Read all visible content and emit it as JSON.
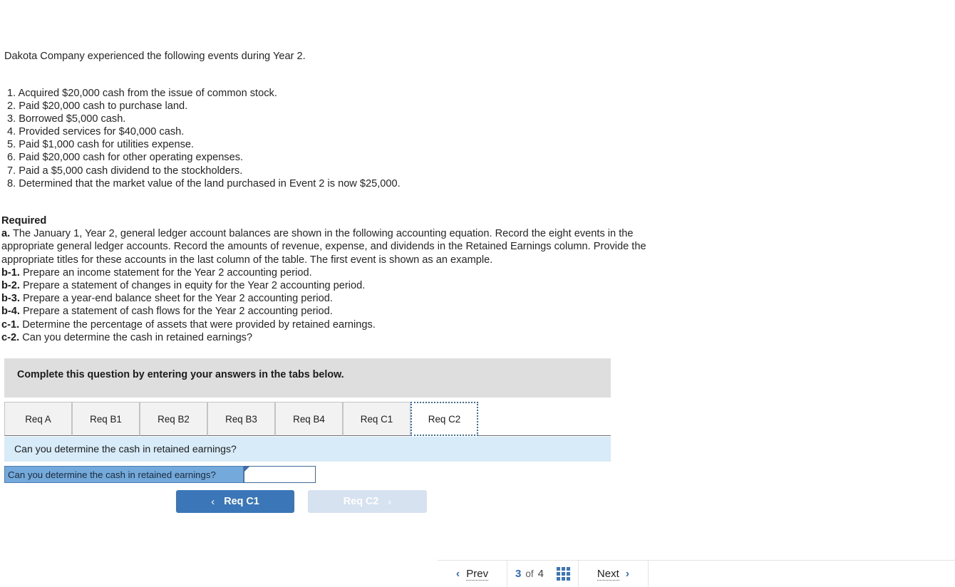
{
  "problem": {
    "intro": "Dakota Company experienced the following events during Year 2.",
    "events": [
      " 1. Acquired $20,000 cash from the issue of common stock.",
      " 2. Paid $20,000 cash to purchase land.",
      " 3. Borrowed $5,000 cash.",
      " 4. Provided services for $40,000 cash.",
      " 5. Paid $1,000 cash for utilities expense.",
      " 6. Paid $20,000 cash for other operating expenses.",
      " 7. Paid a $5,000 cash dividend to the stockholders.",
      " 8. Determined that the market value of the land purchased in Event 2 is now $25,000."
    ]
  },
  "required": {
    "heading": "Required",
    "items": [
      {
        "label": "a.",
        "text": " The January 1, Year 2, general ledger account balances are shown in the following accounting equation. Record the eight events in the appropriate general ledger accounts. Record the amounts of revenue, expense, and dividends in the Retained Earnings column. Provide the appropriate titles for these accounts in the last column of the table. The first event is shown as an example."
      },
      {
        "label": "b-1.",
        "text": " Prepare an income statement for the Year 2 accounting period."
      },
      {
        "label": "b-2.",
        "text": " Prepare a statement of changes in equity for the Year 2 accounting period."
      },
      {
        "label": "b-3.",
        "text": " Prepare a year-end balance sheet for the Year 2 accounting period."
      },
      {
        "label": "b-4.",
        "text": " Prepare a statement of cash flows for the Year 2 accounting period."
      },
      {
        "label": "c-1.",
        "text": " Determine the percentage of assets that were provided by retained earnings."
      },
      {
        "label": "c-2.",
        "text": " Can you determine the cash in retained earnings?"
      }
    ]
  },
  "instruction_banner": {
    "text": "Complete this question by entering your answers in the tabs below."
  },
  "tabs": [
    {
      "label": "Req A",
      "active": false
    },
    {
      "label": "Req B1",
      "active": false
    },
    {
      "label": "Req B2",
      "active": false
    },
    {
      "label": "Req B3",
      "active": false
    },
    {
      "label": "Req B4",
      "active": false
    },
    {
      "label": "Req C1",
      "active": false
    },
    {
      "label": "Req C2",
      "active": true
    }
  ],
  "question_bar": {
    "text": "Can you determine the cash in retained earnings?"
  },
  "answer_row": {
    "label": "Can you determine the cash in retained earnings?",
    "value": "",
    "placeholder": ""
  },
  "nav_buttons": {
    "prev_label": "Req C1",
    "prev_chevron": "‹",
    "next_label": "Req C2",
    "next_chevron": "›"
  },
  "pagination": {
    "prev_label": "Prev",
    "prev_arrow": "‹",
    "current_page": "3",
    "of_label": "of",
    "total_pages": "4",
    "grid_icon": "grid-icon",
    "next_label": "Next",
    "next_arrow": "›"
  },
  "colors": {
    "accent_blue": "#3a76b8",
    "banner_gray": "#dedede",
    "question_blue": "#d7ebf9",
    "answer_label_blue": "#74a9dc"
  }
}
